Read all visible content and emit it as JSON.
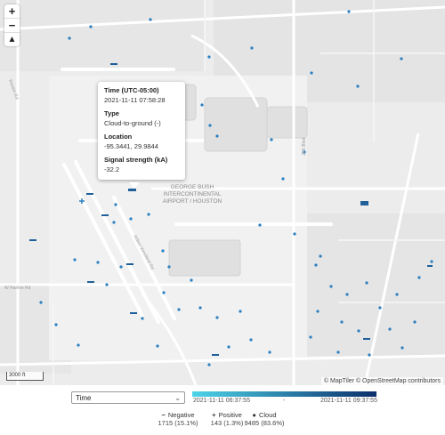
{
  "map": {
    "zoom_in": "+",
    "zoom_out": "−",
    "compass": "▲",
    "airport_label_1": "GEORGE BUSH",
    "airport_label_2": "INTERCONTINENTAL",
    "airport_label_3": "AIRPORT / HOUSTON",
    "road_labels": [
      "Rankin Rd",
      "W Rankin Rd",
      "Aldine Westfield Rd",
      "JFK Blvd"
    ],
    "scale_label": "3000 ft",
    "attribution": {
      "maptiler": "© MapTiler",
      "osm": "© OpenStreetMap contributors"
    }
  },
  "popup": {
    "time_key": "Time (UTC-05:00)",
    "time_value": "2021-11-11 07:58:28",
    "type_key": "Type",
    "type_value": "Cloud-to-ground (-)",
    "location_key": "Location",
    "location_value": "-95.3441, 29.9844",
    "signal_key": "Signal strength (kA)",
    "signal_value": "-32.2"
  },
  "controls": {
    "color_by": "Time",
    "time_start": "2021-11-11 06:37:55",
    "time_end": "2021-11-11 09:37:55",
    "range_sep": "-",
    "colors": {
      "start": "#4dd4e8",
      "end": "#0b2f6b"
    }
  },
  "legend": [
    {
      "symbol": "−",
      "label": "Negative",
      "count": "1715 (15.1%)"
    },
    {
      "symbol": "+",
      "label": "Positive",
      "count": "143 (1.3%)"
    },
    {
      "symbol": "●",
      "label": "Cloud",
      "count": "9485 (83.6%)"
    }
  ]
}
